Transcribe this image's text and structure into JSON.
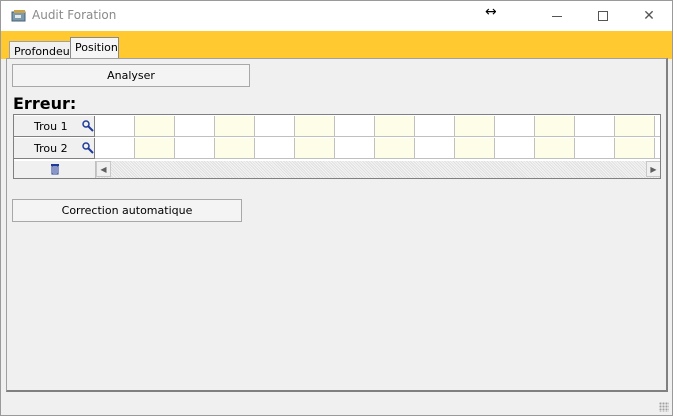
{
  "window": {
    "title": "Audit Foration",
    "minimize_icon": "minimize-icon",
    "maximize_icon": "maximize-icon",
    "close_icon": "close-icon"
  },
  "tabs": [
    {
      "label": "Profondeur",
      "active": false
    },
    {
      "label": "Position",
      "active": true
    }
  ],
  "buttons": {
    "analyser": "Analyser",
    "correction": "Correction automatique"
  },
  "erreur_label": "Erreur:",
  "grid": {
    "rows": [
      {
        "label": "Trou 1"
      },
      {
        "label": "Trou 2"
      }
    ]
  },
  "colors": {
    "accent_band": "#ffc92f",
    "alt_cell": "#fdfde8"
  }
}
